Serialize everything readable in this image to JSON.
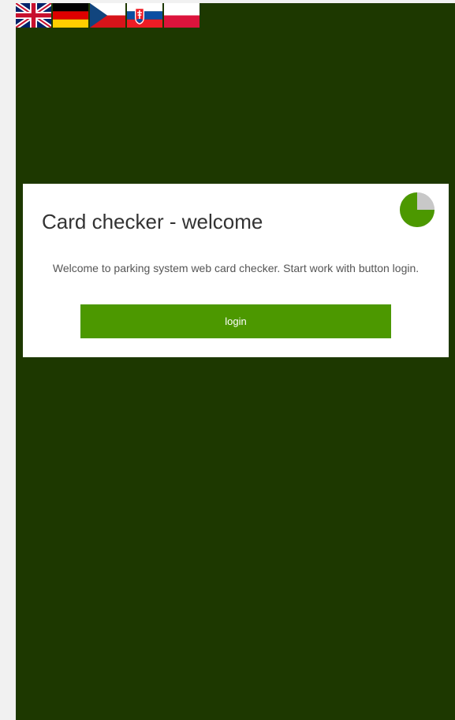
{
  "page": {
    "background_color": "#1d3800",
    "side_color": "#f1f1f1"
  },
  "language_bar": {
    "flags": [
      {
        "language": "English",
        "icon": "uk-flag-icon"
      },
      {
        "language": "German",
        "icon": "germany-flag-icon"
      },
      {
        "language": "Czech",
        "icon": "czech-flag-icon"
      },
      {
        "language": "Slovak",
        "icon": "slovakia-flag-icon"
      },
      {
        "language": "Polish",
        "icon": "poland-flag-icon"
      }
    ]
  },
  "welcome_card": {
    "title": "Card checker - welcome",
    "message": "Welcome to parking system web card checker. Start work with button login.",
    "login_label": "login",
    "timer_icon": "pie-timer-icon",
    "timer_fraction_remaining": 0.75,
    "accent_color": "#4c9800"
  }
}
